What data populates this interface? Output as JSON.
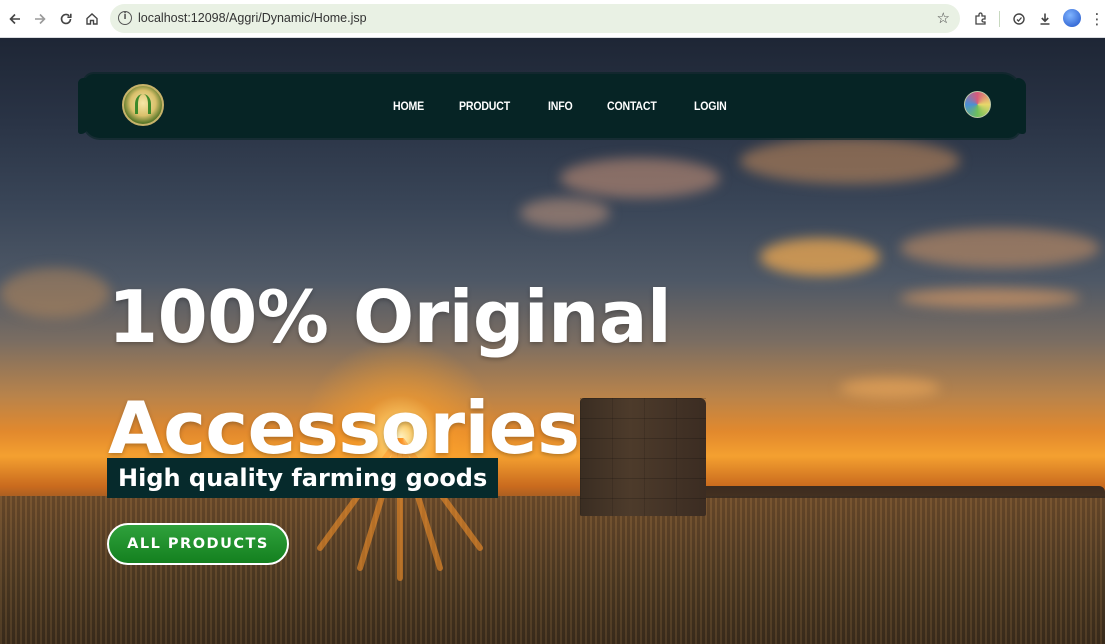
{
  "browser": {
    "url": "localhost:12098/Aggri/Dynamic/Home.jsp",
    "icons": [
      "back-arrow-icon",
      "forward-arrow-icon",
      "reload-icon",
      "home-icon",
      "site-info-icon",
      "bookmark-star-icon",
      "extensions-icon",
      "sync-icon",
      "download-icon",
      "profile-icon",
      "menu-icon"
    ]
  },
  "navbar": {
    "links": [
      "HOME",
      "PRODUCT",
      "INFO",
      "CONTACT",
      "LOGIN"
    ],
    "background_color": "#062425"
  },
  "hero": {
    "headline_line1": "100% Original",
    "headline_line2": "Accessories",
    "subtitle": "High quality farming goods",
    "cta_label": "ALL PRODUCTS",
    "cta_color": "#14801f"
  }
}
